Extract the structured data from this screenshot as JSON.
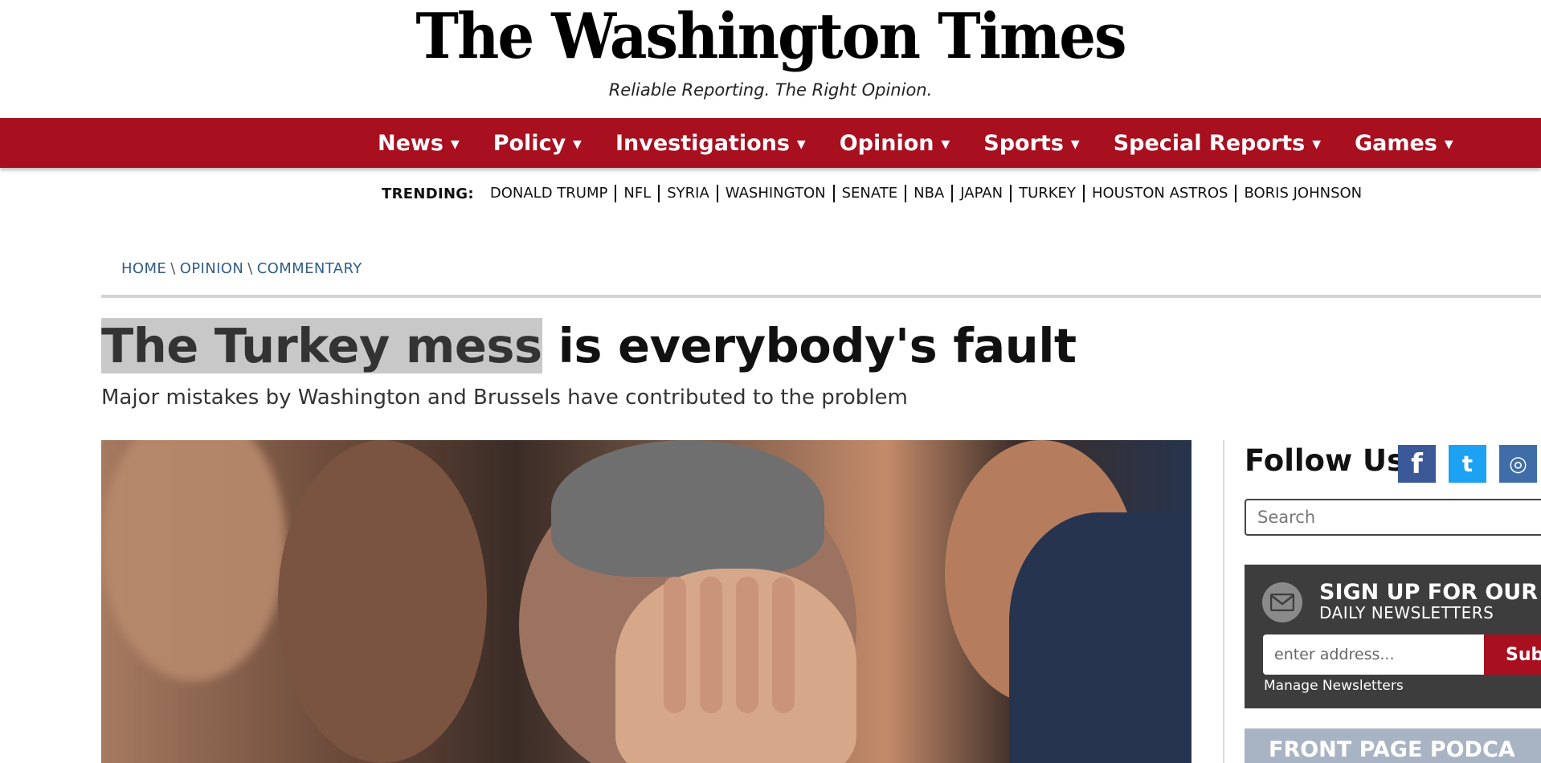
{
  "masthead": {
    "logo": "The Washington Times",
    "tagline": "Reliable Reporting. The Right Opinion."
  },
  "nav": {
    "items": [
      {
        "label": "News"
      },
      {
        "label": "Policy"
      },
      {
        "label": "Investigations"
      },
      {
        "label": "Opinion"
      },
      {
        "label": "Sports"
      },
      {
        "label": "Special Reports"
      },
      {
        "label": "Games"
      }
    ],
    "caret_icon": "caret-down-icon"
  },
  "trending": {
    "label": "TRENDING:",
    "items": [
      "DONALD TRUMP",
      "NFL",
      "SYRIA",
      "WASHINGTON",
      "SENATE",
      "NBA",
      "JAPAN",
      "TURKEY",
      "HOUSTON ASTROS",
      "BORIS JOHNSON"
    ]
  },
  "breadcrumb": {
    "items": [
      "HOME",
      "OPINION",
      "COMMENTARY"
    ],
    "separator": "\\"
  },
  "article": {
    "headline_selected": "The Turkey mess",
    "headline_rest": " is everybody's fault",
    "subheadline": "Major mistakes by Washington and Brussels have contributed to the problem",
    "hero_image": "man-covering-face-with-hands-photo"
  },
  "sidebar": {
    "follow_title": "Follow Us",
    "social": [
      {
        "icon": "facebook-icon",
        "glyph": "f"
      },
      {
        "icon": "twitter-icon",
        "glyph": "t"
      },
      {
        "icon": "instagram-icon",
        "glyph": "◎"
      }
    ],
    "search_placeholder": "Search",
    "newsletter": {
      "title": "SIGN UP FOR OUR",
      "subtitle": "DAILY NEWSLETTERS",
      "input_placeholder": "enter address...",
      "button_label": "Subm",
      "manage_label": "Manage Newsletters"
    },
    "podcast_title": "FRONT PAGE PODCA"
  },
  "colors": {
    "nav_red": "#a80f1f",
    "newsletter_bg": "#3d3d3d",
    "breadcrumb_blue": "#2f5d8a",
    "podcast_bg": "#a8b4c4"
  }
}
